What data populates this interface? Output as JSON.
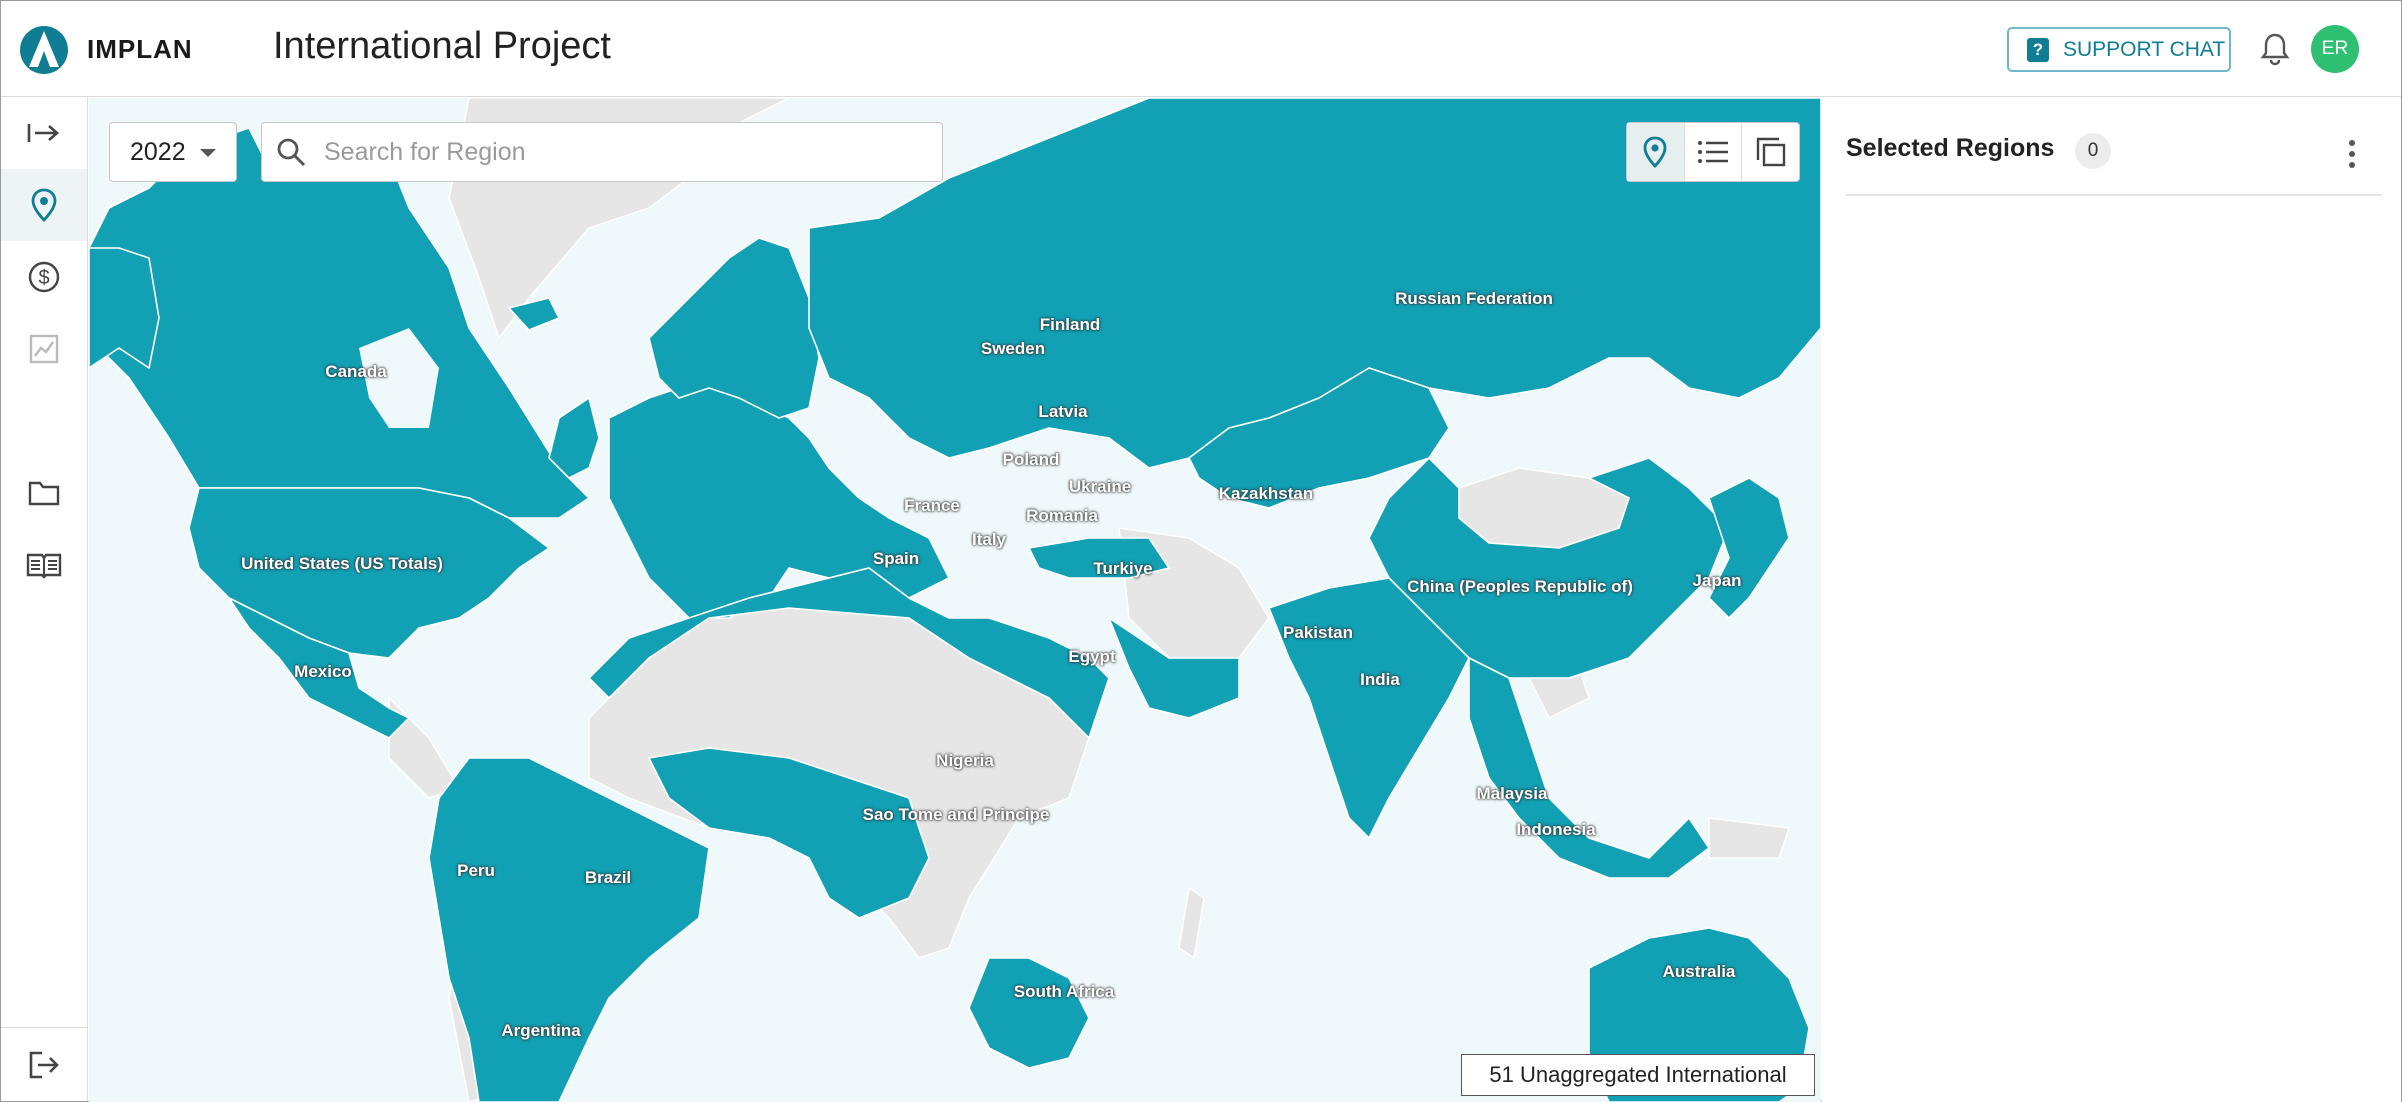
{
  "app": {
    "brand": "IMPLAN",
    "title": "International Project"
  },
  "header": {
    "support_label": "SUPPORT CHAT",
    "avatar_initials": "ER"
  },
  "toolbar": {
    "year": "2022",
    "search_placeholder": "Search for Region"
  },
  "panel": {
    "title": "Selected Regions",
    "count": "0"
  },
  "map": {
    "footer": "51 Unaggregated International",
    "colors": {
      "ocean": "#eff8fa",
      "selected": "#11a0b4",
      "unselected": "#e6e6e6",
      "accent": "#0f7d94"
    },
    "labels": {
      "canada": "Canada",
      "usa": "United States (US Totals)",
      "mexico": "Mexico",
      "peru": "Peru",
      "brazil": "Brazil",
      "argentina": "Argentina",
      "finland": "Finland",
      "sweden": "Sweden",
      "latvia": "Latvia",
      "poland": "Poland",
      "ukraine": "Ukraine",
      "france": "France",
      "romania": "Romania",
      "italy": "Italy",
      "spain": "Spain",
      "turkiye": "Turkiye",
      "russia": "Russian Federation",
      "kazakhstan": "Kazakhstan",
      "china": "China (Peoples Republic of)",
      "japan": "Japan",
      "pakistan": "Pakistan",
      "india": "India",
      "egypt": "Egypt",
      "nigeria": "Nigeria",
      "saotome": "Sao Tome and Principe",
      "malaysia": "Malaysia",
      "indonesia": "Indonesia",
      "south_africa": "South Africa",
      "australia": "Australia"
    }
  },
  "icons": {
    "sidebar": [
      "expand-arrow-icon",
      "map-pin-icon",
      "dollar-icon",
      "chart-icon",
      "folder-icon",
      "book-icon",
      "logout-icon"
    ],
    "views": [
      "map-pin-icon",
      "list-icon",
      "copy-icon"
    ]
  }
}
